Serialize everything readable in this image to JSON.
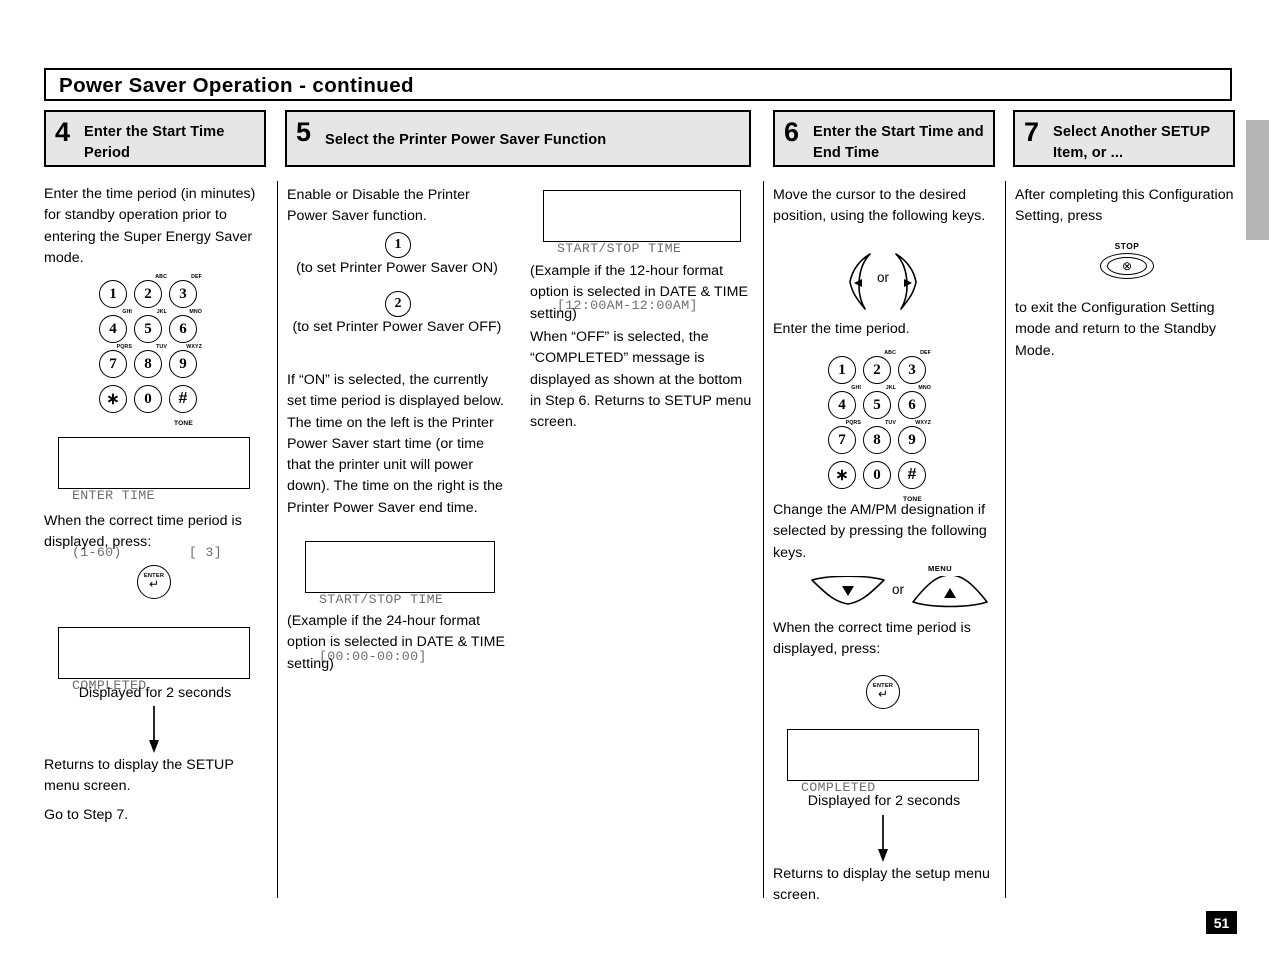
{
  "page": {
    "title": "Power Saver Operation - continued",
    "page_number": "51"
  },
  "steps": [
    {
      "number": "4",
      "title": "Enter the Start Time Period",
      "intro": "Enter the time period (in minutes) for standby operation prior to entering the Super Energy Saver mode.",
      "lcd_1": {
        "line1": "ENTER TIME",
        "line2_left": "(1-60)",
        "line2_right": "[ 3]"
      },
      "press_prompt": "When the correct time period is displayed,  press:",
      "enter_button": {
        "label": "ENTER",
        "glyph": "↵"
      },
      "lcd_2": {
        "line1": "COMPLETED"
      },
      "display_note": "Displayed for 2 seconds",
      "returns": "Returns to display the SETUP menu screen.",
      "goto": "Go to Step 7."
    },
    {
      "number": "5",
      "title": "Select the Printer Power Saver Function",
      "intro": "Enable or Disable the Printer Power Saver function.",
      "key_on": "1",
      "key_on_caption": "(to set  Printer Power Saver ON)",
      "key_off": "2",
      "key_off_caption": "(to set Printer Power Saver OFF)",
      "on_paragraph": "If “ON” is selected, the currently set time period is displayed below. The time on the left is the Printer Power Saver start time (or time that the printer unit will power down). The time on the right is the Printer Power Saver end time.",
      "lcd_24h": {
        "line1": "START/STOP TIME",
        "line2": "[00:00-00:00]"
      },
      "note_24h": "(Example if the 24-hour format option is selected in DATE & TIME  setting)",
      "lcd_12h": {
        "line1": "START/STOP TIME",
        "line2": "[12:00AM-12:00AM]"
      },
      "note_12h": "(Example if the 12-hour format option is selected in DATE & TIME  setting)",
      "off_paragraph": "When “OFF” is selected, the “COMPLETED” message is displayed as shown at the bottom in Step 6. Returns to SETUP menu screen."
    },
    {
      "number": "6",
      "title": "Enter the Start Time and End Time",
      "intro": "Move the cursor to the desired position, using the following keys.",
      "lr_or": "or",
      "enter_period": "Enter the time period.",
      "ampm_text": "Change the AM/PM designation if selected by pressing the following  keys.",
      "ud_or": "or",
      "menu_label": "MENU",
      "press_prompt": "When the correct time period is displayed,  press:",
      "enter_button": {
        "label": "ENTER",
        "glyph": "↵"
      },
      "lcd": {
        "line1": "COMPLETED"
      },
      "display_note": "Displayed for 2 seconds",
      "returns": "Returns to display the setup menu screen."
    },
    {
      "number": "7",
      "title": "Select Another SETUP Item, or ...",
      "intro": "After completing this Configuration Setting, press",
      "stop_button": {
        "label": "STOP",
        "glyph": "⊗"
      },
      "outro": "to exit the Configuration Setting mode and return to the Standby Mode."
    }
  ],
  "keypad": {
    "keys": [
      {
        "digit": "1",
        "letters": ""
      },
      {
        "digit": "2",
        "letters": "ABC"
      },
      {
        "digit": "3",
        "letters": "DEF"
      },
      {
        "digit": "4",
        "letters": "GHI"
      },
      {
        "digit": "5",
        "letters": "JKL"
      },
      {
        "digit": "6",
        "letters": "MNO"
      },
      {
        "digit": "7",
        "letters": "PQRS"
      },
      {
        "digit": "8",
        "letters": "TUV"
      },
      {
        "digit": "9",
        "letters": "WXYZ"
      },
      {
        "digit": "∗",
        "letters": ""
      },
      {
        "digit": "0",
        "letters": ""
      },
      {
        "digit": "#",
        "letters": "",
        "bottom": "TONE"
      }
    ]
  },
  "colors": {
    "step_header_bg": "#e6e6e6",
    "tab_gray": "#b4b4b4",
    "lcd_text": "#6e6e6e",
    "page_badge_bg": "#000000"
  }
}
